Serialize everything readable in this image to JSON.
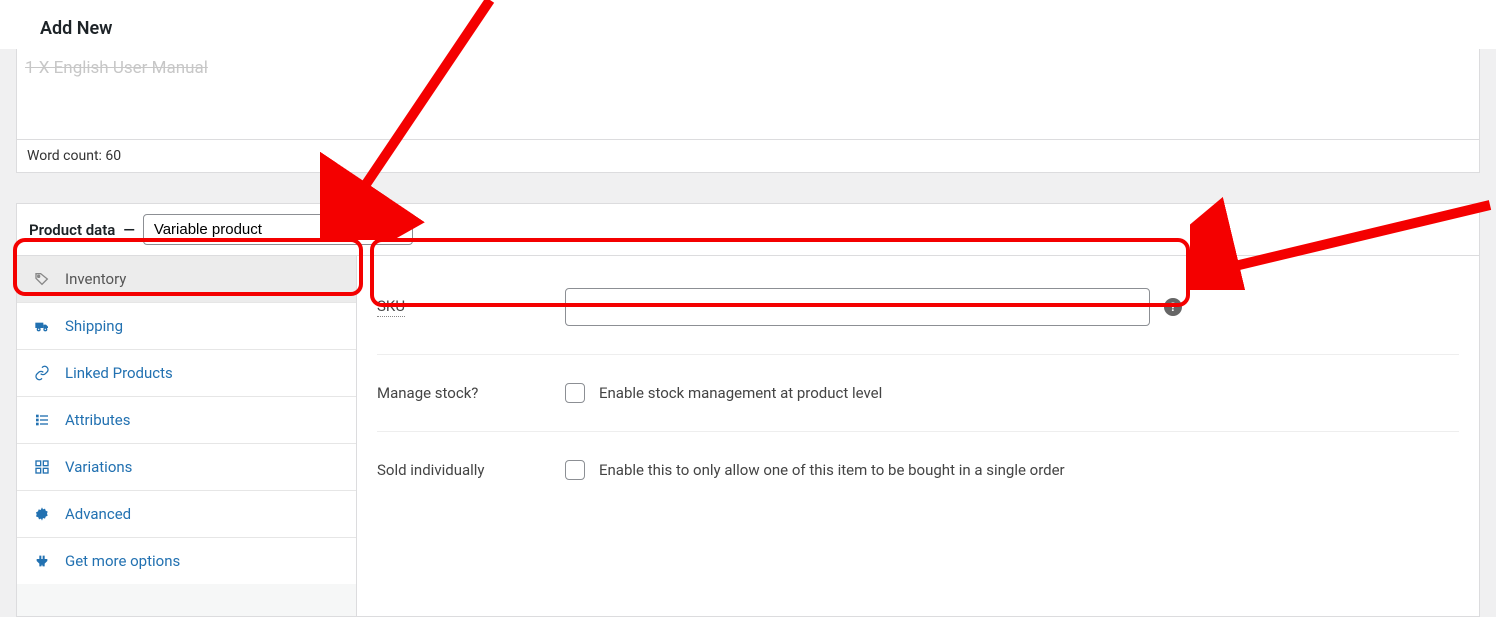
{
  "page": {
    "title": "Add New"
  },
  "editor": {
    "trailing_text": "1 X English User Manual",
    "word_count_label": "Word count: 60"
  },
  "product_data": {
    "header_label": "Product data",
    "dash": "—",
    "type_selected": "Variable product",
    "tabs": [
      {
        "key": "inventory",
        "label": "Inventory",
        "active": true
      },
      {
        "key": "shipping",
        "label": "Shipping",
        "active": false
      },
      {
        "key": "linked",
        "label": "Linked Products",
        "active": false
      },
      {
        "key": "attributes",
        "label": "Attributes",
        "active": false
      },
      {
        "key": "variations",
        "label": "Variations",
        "active": false
      },
      {
        "key": "advanced",
        "label": "Advanced",
        "active": false
      },
      {
        "key": "more",
        "label": "Get more options",
        "active": false
      }
    ],
    "fields": {
      "sku": {
        "label": "SKU",
        "value": "",
        "help": "?"
      },
      "manage_stock": {
        "label": "Manage stock?",
        "checkbox_label": "Enable stock management at product level",
        "checked": false
      },
      "sold_individually": {
        "label": "Sold individually",
        "checkbox_label": "Enable this to only allow one of this item to be bought in a single order",
        "checked": false
      }
    }
  }
}
